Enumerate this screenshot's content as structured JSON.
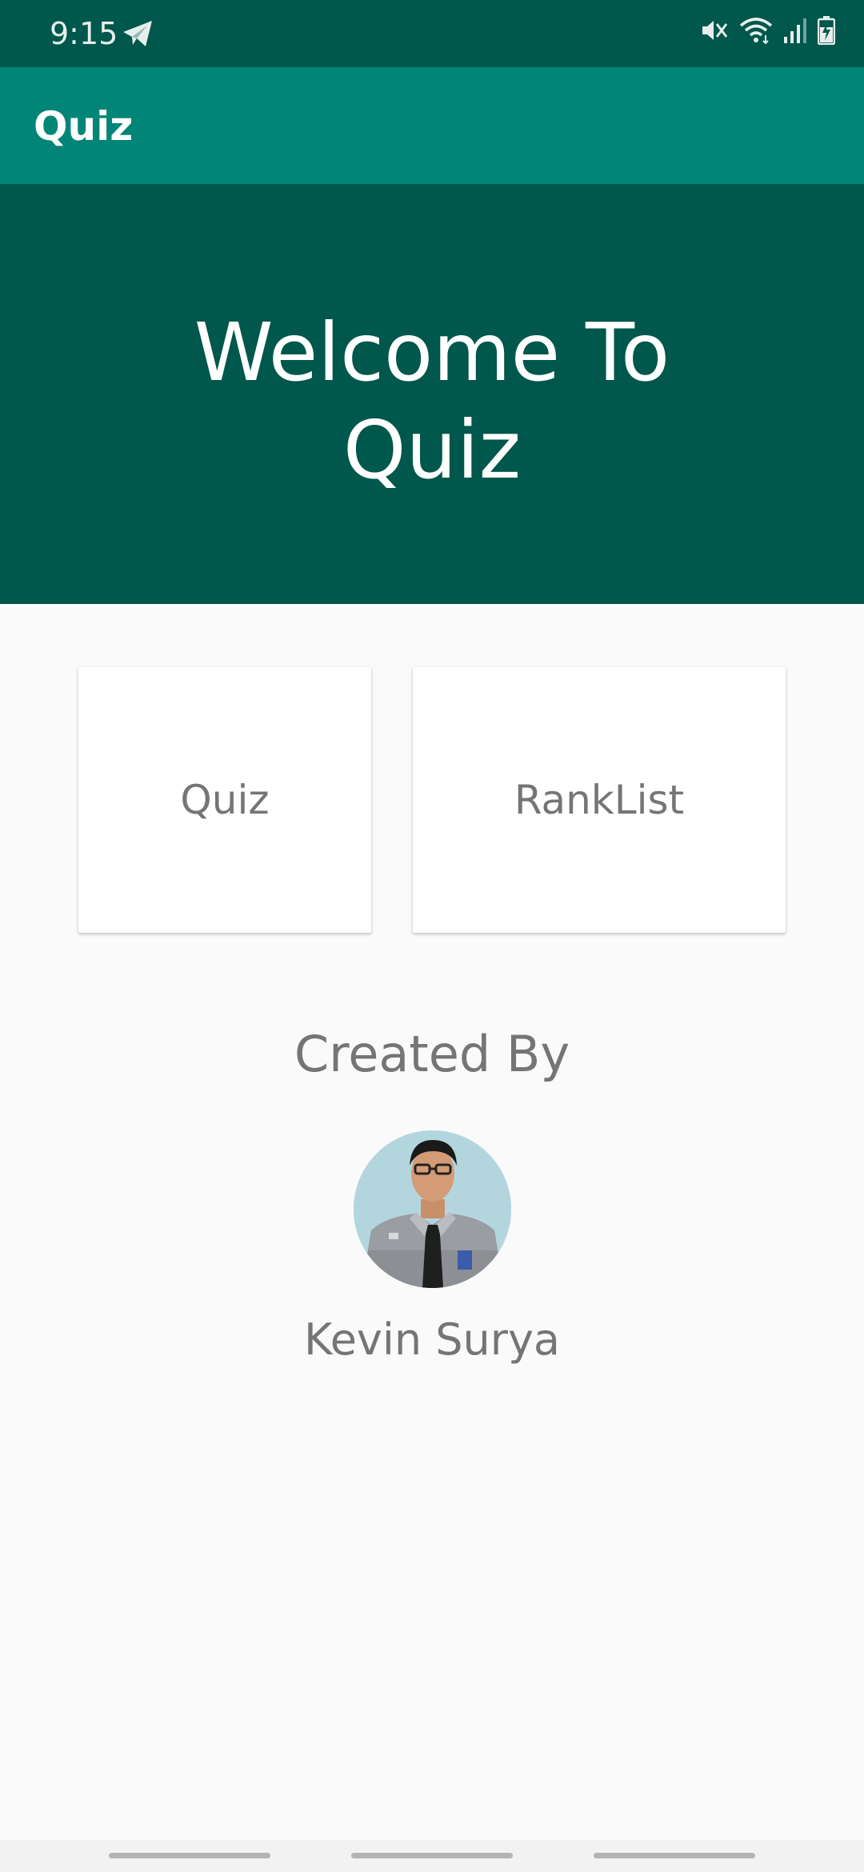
{
  "status_bar": {
    "time": "9:15",
    "icons": [
      "telegram-icon",
      "mute-icon",
      "wifi-icon",
      "signal-icon",
      "battery-charging-icon"
    ]
  },
  "app_bar": {
    "title": "Quiz"
  },
  "hero": {
    "title_line1": "Welcome To",
    "title_line2": "Quiz"
  },
  "cards": {
    "quiz_label": "Quiz",
    "ranklist_label": "RankList"
  },
  "creator": {
    "heading": "Created By",
    "name": "Kevin Surya"
  },
  "colors": {
    "primary": "#008577",
    "primary_dark": "#00574b",
    "background": "#fafafa",
    "text_secondary": "#757575"
  }
}
